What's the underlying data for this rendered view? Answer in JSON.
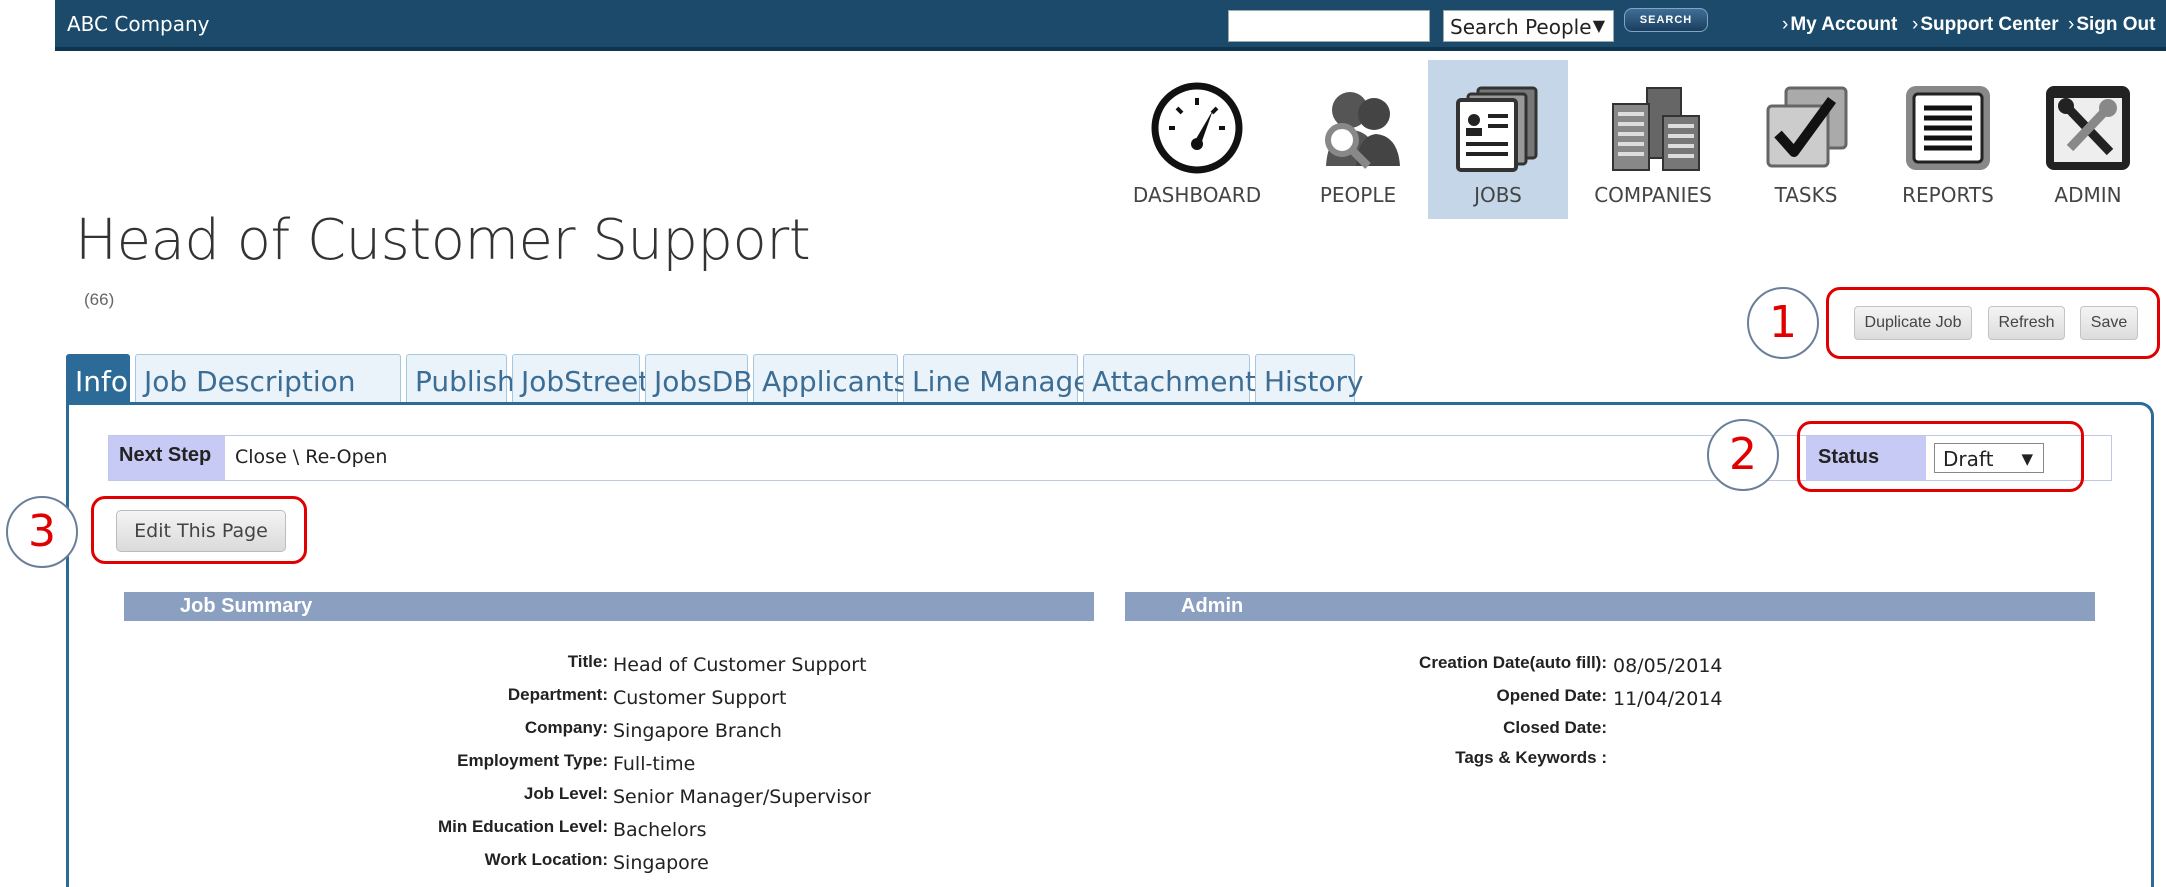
{
  "topbar": {
    "brand": "ABC Company",
    "search_value": "",
    "search_scope": "Search People",
    "search_button": "SEARCH",
    "links": [
      "My Account",
      "Support Center",
      "Sign Out"
    ]
  },
  "nav": [
    {
      "label": "DASHBOARD",
      "icon": "gauge-icon",
      "active": false
    },
    {
      "label": "PEOPLE",
      "icon": "people-search-icon",
      "active": false
    },
    {
      "label": "JOBS",
      "icon": "jobs-cards-icon",
      "active": true
    },
    {
      "label": "COMPANIES",
      "icon": "buildings-icon",
      "active": false
    },
    {
      "label": "TASKS",
      "icon": "checkbox-icon",
      "active": false
    },
    {
      "label": "REPORTS",
      "icon": "report-icon",
      "active": false
    },
    {
      "label": "ADMIN",
      "icon": "tools-icon",
      "active": false
    }
  ],
  "page": {
    "title": "Head of Customer Support",
    "count": "(66)"
  },
  "actions": {
    "duplicate": "Duplicate Job",
    "refresh": "Refresh",
    "save": "Save"
  },
  "callouts": [
    "1",
    "2",
    "3"
  ],
  "tabs": [
    "Info",
    "Job Description",
    "Publish",
    "JobStreet",
    "JobsDB",
    "Applicants",
    "Line Manager",
    "Attachments",
    "History"
  ],
  "workflow": {
    "next_step_label": "Next Step",
    "next_step_value": "Close \\ Re-Open",
    "status_label": "Status",
    "status_value": "Draft"
  },
  "edit_button": "Edit This Page",
  "job_summary": {
    "heading": "Job Summary",
    "fields": [
      {
        "label": "Title:",
        "value": "Head of Customer Support"
      },
      {
        "label": "Department:",
        "value": "Customer Support"
      },
      {
        "label": "Company:",
        "value": "Singapore Branch"
      },
      {
        "label": "Employment Type:",
        "value": "Full-time"
      },
      {
        "label": "Job Level:",
        "value": "Senior Manager/Supervisor"
      },
      {
        "label": "Min Education Level:",
        "value": "Bachelors"
      },
      {
        "label": "Work Location:",
        "value": "Singapore"
      }
    ]
  },
  "admin": {
    "heading": "Admin",
    "fields": [
      {
        "label": "Creation Date(auto fill):",
        "value": "08/05/2014"
      },
      {
        "label": "Opened Date:",
        "value": "11/04/2014"
      },
      {
        "label": "Closed Date:",
        "value": ""
      },
      {
        "label": "Tags & Keywords :",
        "value": ""
      }
    ]
  },
  "colors": {
    "topbar": "#1b4a6b",
    "tab_active": "#2c6a98",
    "section_head": "#8b9fc0",
    "label_bg": "#c7caf5",
    "callout": "#e00000"
  }
}
